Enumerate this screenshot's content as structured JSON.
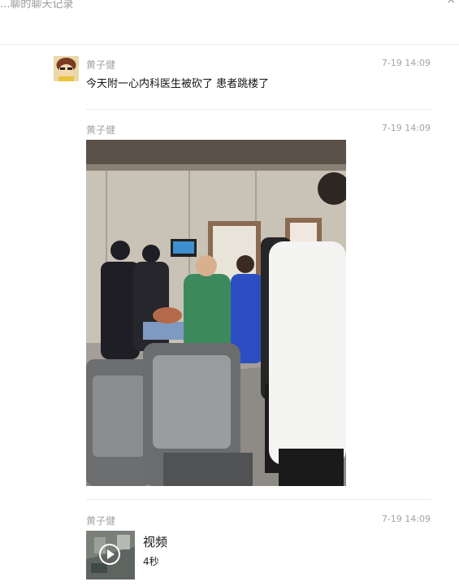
{
  "window": {
    "title": "...聊的聊天记录",
    "close_symbol": "×"
  },
  "messages": [
    {
      "sender": "黄子健",
      "time": "7-19 14:09",
      "text": "今天附一心内科医生被砍了 患者跳楼了"
    },
    {
      "sender": "黄子健",
      "time": "7-19 14:09",
      "type": "image"
    },
    {
      "sender": "黄子健",
      "time": "7-19 14:09",
      "type": "video",
      "video_title": "视频",
      "duration": "4秒"
    }
  ],
  "icons": {
    "avatar": "avatar-cartoon-icon",
    "play": "play-icon"
  }
}
